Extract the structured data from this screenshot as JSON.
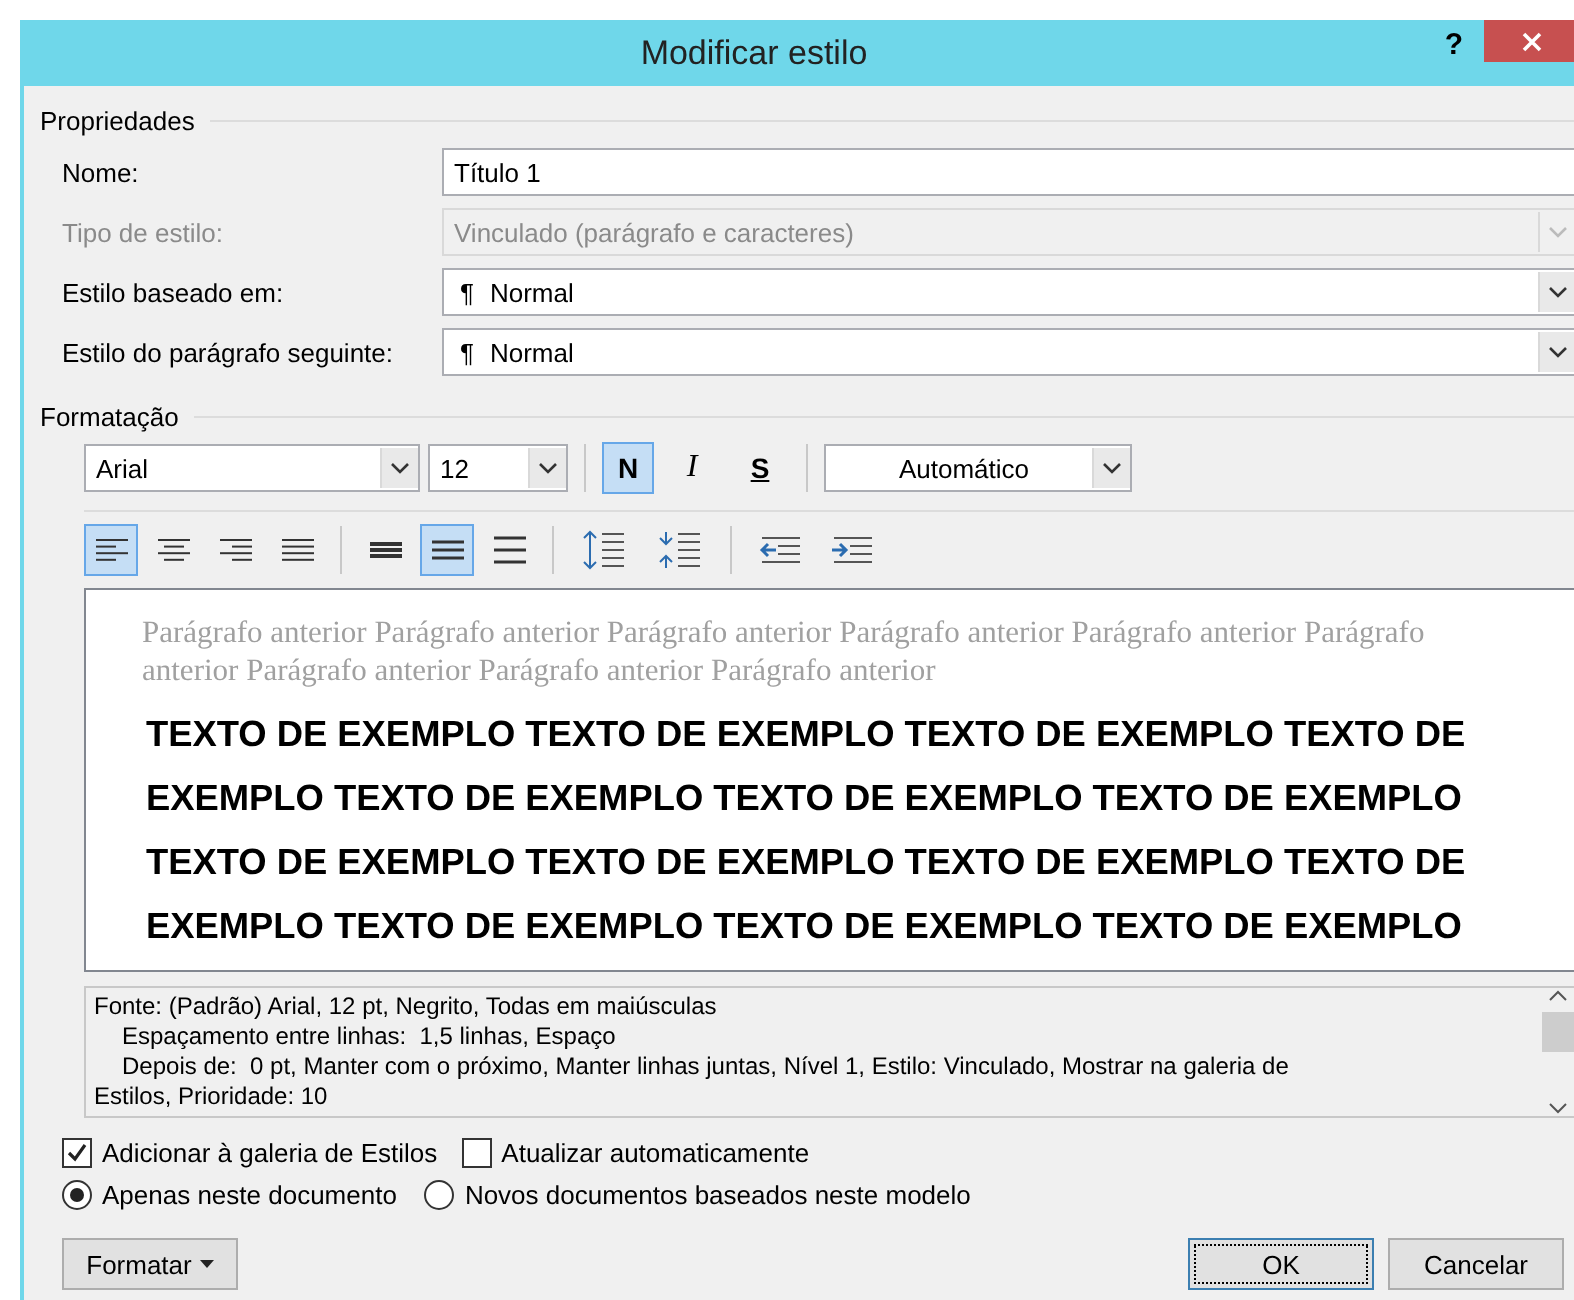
{
  "window": {
    "title": "Modificar estilo",
    "help": "?"
  },
  "properties": {
    "heading": "Propriedades",
    "fields": [
      {
        "label": "Nome:",
        "kind": "text",
        "value": "Título 1",
        "disabled": false
      },
      {
        "label": "Tipo de estilo:",
        "kind": "select",
        "value": "Vinculado (parágrafo e caracteres)",
        "disabled": true
      },
      {
        "label": "Estilo baseado em:",
        "kind": "select",
        "mark": "¶",
        "value": "Normal",
        "disabled": false
      },
      {
        "label": "Estilo do parágrafo seguinte:",
        "kind": "select",
        "mark": "¶",
        "value": "Normal",
        "disabled": false
      }
    ]
  },
  "formatting": {
    "heading": "Formatação",
    "font": "Arial",
    "size": "12",
    "styles": [
      {
        "label": "N",
        "kind": "bold",
        "selected": true
      },
      {
        "label": "I",
        "kind": "italic",
        "selected": false
      },
      {
        "label": "S",
        "kind": "underline",
        "selected": false
      }
    ],
    "color_name": "Automático",
    "alignment": [
      {
        "kind": "left",
        "selected": true
      },
      {
        "kind": "center",
        "selected": false
      },
      {
        "kind": "right",
        "selected": false
      },
      {
        "kind": "justify",
        "selected": false
      }
    ],
    "line_spacing": [
      {
        "kind": "single",
        "selected": false
      },
      {
        "kind": "onehalf",
        "selected": true
      },
      {
        "kind": "double",
        "selected": false
      }
    ],
    "paragraph_spacing": [
      {
        "kind": "increase"
      },
      {
        "kind": "decrease"
      }
    ],
    "indent": [
      {
        "kind": "decrease"
      },
      {
        "kind": "increase"
      }
    ]
  },
  "preview": {
    "previous": "Parágrafo anterior Parágrafo anterior Parágrafo anterior Parágrafo anterior Parágrafo anterior Parágrafo anterior Parágrafo anterior Parágrafo anterior Parágrafo anterior",
    "sample": "TEXTO DE EXEMPLO TEXTO DE EXEMPLO TEXTO DE EXEMPLO TEXTO DE EXEMPLO TEXTO DE EXEMPLO TEXTO DE EXEMPLO TEXTO DE EXEMPLO TEXTO DE EXEMPLO TEXTO DE EXEMPLO TEXTO DE EXEMPLO TEXTO DE EXEMPLO TEXTO DE EXEMPLO TEXTO DE EXEMPLO TEXTO DE EXEMPLO"
  },
  "description": [
    {
      "text": "Fonte: (Padrão) Arial, 12 pt, Negrito, Todas em maiúsculas",
      "indented": false
    },
    {
      "text": "Espaçamento entre linhas:  1,5 linhas, Espaço",
      "indented": true
    },
    {
      "text": "Depois de:  0 pt, Manter com o próximo, Manter linhas juntas, Nível 1, Estilo: Vinculado, Mostrar na galeria de",
      "indented": true
    },
    {
      "text": "Estilos, Prioridade: 10",
      "indented": false
    }
  ],
  "checkboxes": [
    {
      "label": "Adicionar à galeria de Estilos",
      "checked": true
    },
    {
      "label": "Atualizar automaticamente",
      "checked": false
    }
  ],
  "radios": [
    {
      "label": "Apenas neste documento",
      "selected": true
    },
    {
      "label": "Novos documentos baseados neste modelo",
      "selected": false
    }
  ],
  "buttons": [
    {
      "label": "Formatar",
      "kind": "menu"
    },
    {
      "label": "OK",
      "kind": "default"
    },
    {
      "label": "Cancelar",
      "kind": "normal"
    }
  ]
}
